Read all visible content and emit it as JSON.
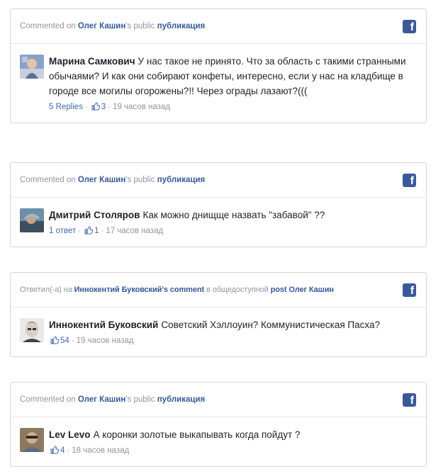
{
  "cards": [
    {
      "header": {
        "prefix": "Commented on",
        "name": "Олег Кашин",
        "middle": "'s public",
        "target": "публикация",
        "suffix": ""
      },
      "author": "Марина Самкович",
      "text": "У нас такое не принято. Что за область с такими странными обычаями? И как они собирают конфеты, интересно, если у нас на кладбище в городе все могилы огорожены?!! Через ограды лазают?(((",
      "replies": "5 Replies",
      "likes": "3",
      "time": "19 часов назад"
    },
    {
      "header": {
        "prefix": "Commented on",
        "name": "Олег Кашин",
        "middle": "'s public",
        "target": "публикация",
        "suffix": ""
      },
      "author": "Дмитрий Столяров",
      "text": "Как можно днищще назвать \"забавой\" ??",
      "replies": "1 ответ",
      "likes": "1",
      "time": "17 часов назад"
    },
    {
      "header": {
        "prefix": "Ответил(-а) на",
        "name": "Иннокентий Буковский's comment",
        "middle": "в общедоступной",
        "target": "post",
        "suffix": "Олег Кашин"
      },
      "author": "Иннокентий Буковский",
      "text": "Советский Хэллоуин? Коммунистическая Пасха?",
      "replies": "",
      "likes": "54",
      "time": "19 часов назад"
    },
    {
      "header": {
        "prefix": "Commented on",
        "name": "Олег Кашин",
        "middle": "'s public",
        "target": "публикация",
        "suffix": ""
      },
      "author": "Lev Levo",
      "text": "А коронки золотые выкапывать когда пойдут ?",
      "replies": "",
      "likes": "4",
      "time": "18 часов назад"
    }
  ],
  "colors": {
    "link": "#365899",
    "meta": "#90949c",
    "facebook": "#3b5998"
  },
  "icons": {
    "platform": "facebook-icon",
    "like": "thumbs-up-icon"
  }
}
